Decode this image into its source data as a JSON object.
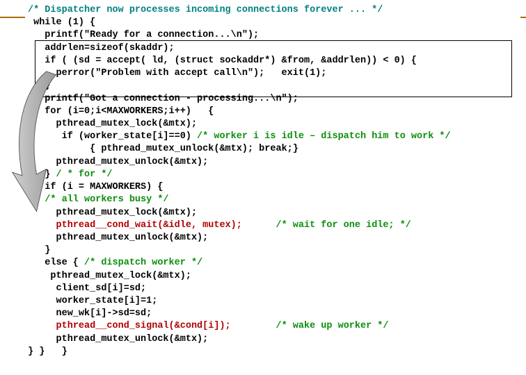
{
  "code": {
    "l1_a": "/* Dispatcher now processes incoming connections forever ... */",
    "l2": " while (1) {",
    "l3": "   printf(\"Ready for a connection...\\n\");",
    "l4": "   addrlen=sizeof(skaddr);",
    "l5": "   if ( (sd = accept( ld, (struct sockaddr*) &from, &addrlen)) < 0) {",
    "l6": "     perror(\"Problem with accept call\\n\");   exit(1);",
    "l7": "   }",
    "l8": "   printf(\"Got a connection - processing...\\n\");",
    "l9": "   for (i=0;i<MAXWORKERS;i++)   {",
    "l10": "     pthread_mutex_lock(&mtx);",
    "l11a": "      if (worker_state[i]==0) ",
    "l11b": "/* worker i is idle – dispatch him to work */",
    "l12": "           { pthread_mutex_unlock(&mtx); break;}",
    "l13": "     pthread_mutex_unlock(&mtx);",
    "l14a": "   } ",
    "l14b": "/ * for */",
    "l15": "   if (i = MAXWORKERS) {",
    "l16": "   /* all workers busy */",
    "l17": "     pthread_mutex_lock(&mtx);",
    "l18a": "     ",
    "l18b": "pthread__cond_wait(&idle, mutex);",
    "l18c": "      ",
    "l18d": "/* wait for one idle; */",
    "l19": "     pthread_mutex_unlock(&mtx);",
    "l20": "   }",
    "l21a": "   else { ",
    "l21b": "/* dispatch worker */",
    "l22": "    pthread_mutex_lock(&mtx);",
    "l23": "     client_sd[i]=sd;",
    "l24": "     worker_state[i]=1;",
    "l25": "     new_wk[i]->sd=sd;",
    "l26a": "     ",
    "l26b": "pthread__cond_signal(&cond[i]);",
    "l26c": "        ",
    "l26d": "/* wake up worker */",
    "l27": "     pthread_mutex_unlock(&mtx);",
    "l28": "} }   }"
  }
}
